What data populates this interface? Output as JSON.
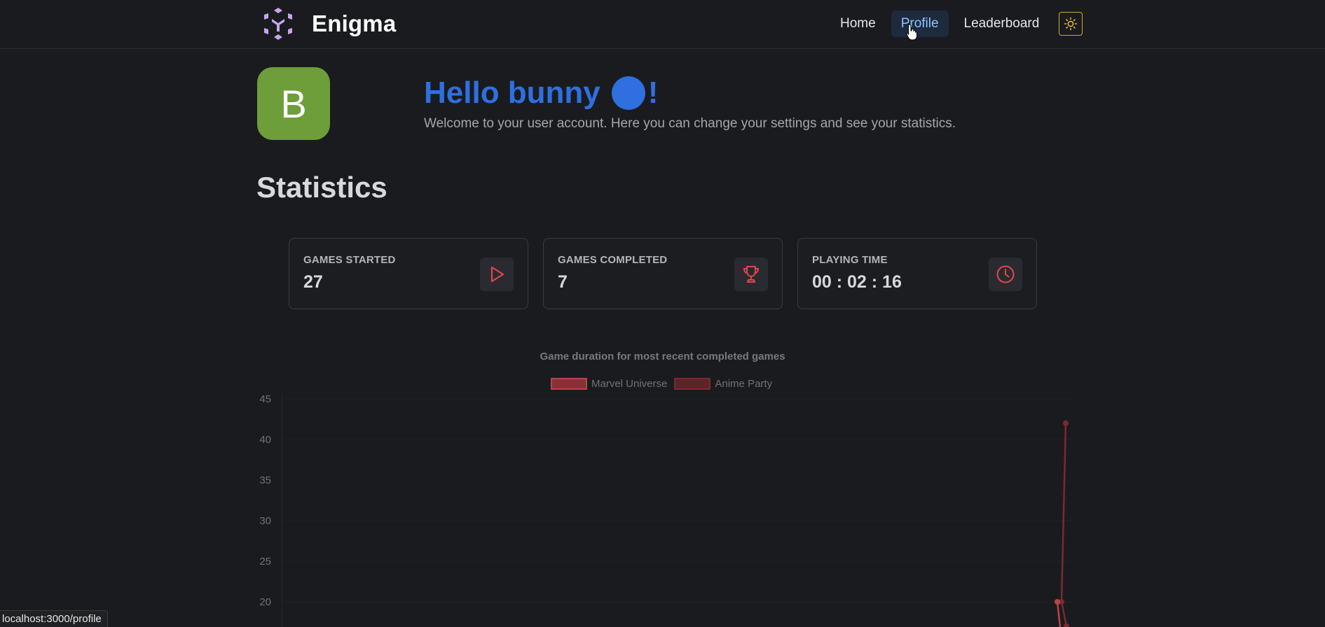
{
  "nav": {
    "brand": "Enigma",
    "links": [
      "Home",
      "Profile",
      "Leaderboard"
    ],
    "active": "Profile",
    "theme_icon": "sun-icon"
  },
  "profile": {
    "avatar_letter": "B",
    "greeting_prefix": "Hello bunny",
    "greeting_suffix": "!",
    "welcome": "Welcome to your user account. Here you can change your settings and see your statistics."
  },
  "statistics": {
    "title": "Statistics",
    "cards": [
      {
        "label": "GAMES STARTED",
        "value": "27",
        "icon": "play-icon"
      },
      {
        "label": "GAMES COMPLETED",
        "value": "7",
        "icon": "trophy-icon"
      },
      {
        "label": "PLAYING TIME",
        "value": "00 : 02 : 16",
        "icon": "clock-icon"
      }
    ]
  },
  "chart_data": {
    "type": "line",
    "title": "Game duration for most recent completed games",
    "series": [
      {
        "name": "Marvel Universe",
        "color": "#b8434a"
      },
      {
        "name": "Anime Party",
        "color": "#7a2a30"
      }
    ],
    "y_ticks": [
      45,
      40,
      35,
      30,
      25,
      20
    ],
    "ylim": [
      15,
      45
    ],
    "visible_points": [
      {
        "y": 42,
        "series": "Anime Party"
      },
      {
        "y": 20,
        "series": "Anime Party"
      },
      {
        "y": 17,
        "series": "Anime Party"
      },
      {
        "y": 20,
        "series": "Marvel Universe"
      }
    ],
    "grid": true
  },
  "status_bar": {
    "url": "localhost:3000/profile"
  },
  "colors": {
    "background": "#1a1b1f",
    "accent_blue": "#2f6fe0",
    "avatar_green": "#6d9e3a",
    "icon_red": "#e0464e",
    "theme_border": "#d4a72c"
  }
}
